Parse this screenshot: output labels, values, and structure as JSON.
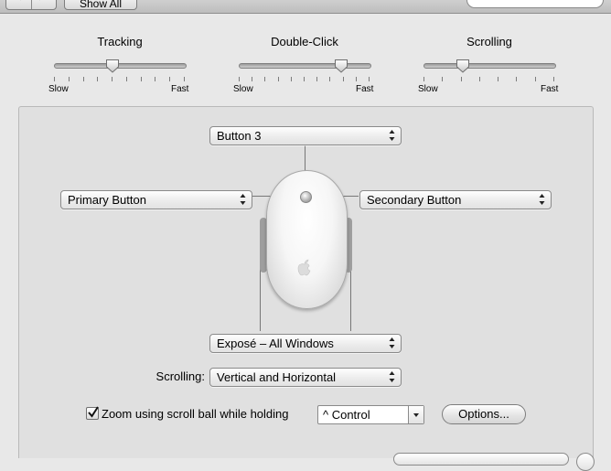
{
  "toolbar": {
    "back_glyph": "◀",
    "forward_glyph": "▶",
    "show_all_label": "Show All",
    "search_placeholder": ""
  },
  "sliders": [
    {
      "title": "Tracking",
      "min_label": "Slow",
      "max_label": "Fast",
      "value": 0.45,
      "ticks": 10
    },
    {
      "title": "Double-Click",
      "min_label": "Slow",
      "max_label": "Fast",
      "value": 0.78,
      "ticks": 11
    },
    {
      "title": "Scrolling",
      "min_label": "Slow",
      "max_label": "Fast",
      "value": 0.3,
      "ticks": 8
    }
  ],
  "buttons_config": {
    "top_button": "Button 3",
    "left_button": "Primary Button",
    "right_button": "Secondary Button",
    "bottom_button": "Exposé – All Windows"
  },
  "scrolling": {
    "label": "Scrolling:",
    "value": "Vertical and Horizontal"
  },
  "zoom": {
    "checked": true,
    "label": "Zoom using scroll ball while holding",
    "modifier": "^ Control",
    "options_button": "Options..."
  }
}
